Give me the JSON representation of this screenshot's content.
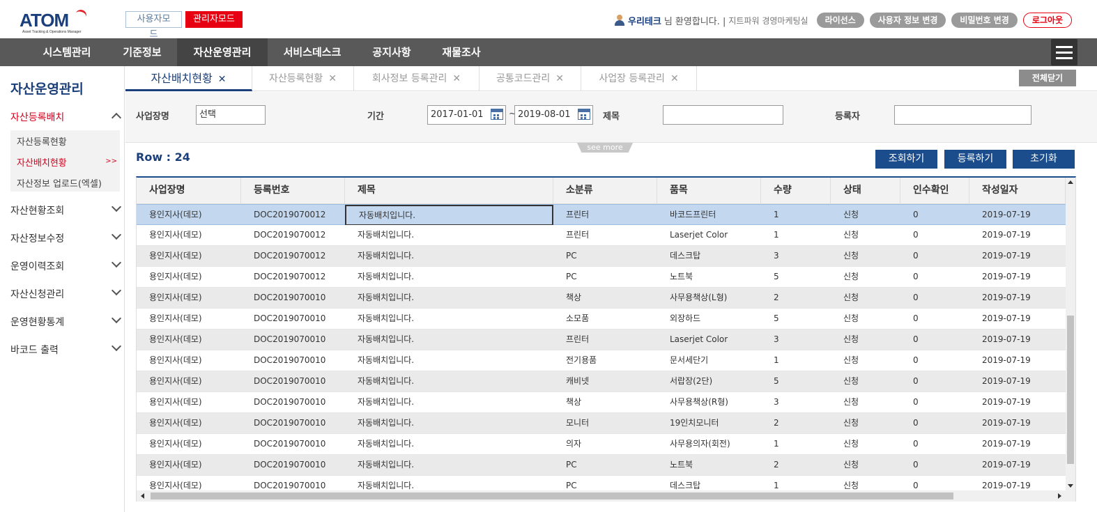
{
  "logo": {
    "text": "ATOM",
    "subtitle": "Asset Tracking & Operations Manager"
  },
  "modes": {
    "user": "사용자모드",
    "admin": "관리자모드"
  },
  "user_bar": {
    "company": "우리테크",
    "welcome": "님 환영합니다. |",
    "org": "지트파워 경영마케팅실",
    "buttons": [
      "라이선스",
      "사용자 정보 변경",
      "비밀번호 변경"
    ],
    "logout": "로그아웃"
  },
  "nav": {
    "items": [
      "시스템관리",
      "기준정보",
      "자산운영관리",
      "서비스데스크",
      "공지사항",
      "재물조사"
    ],
    "active": "자산운영관리"
  },
  "sidebar": {
    "title": "자산운영관리",
    "open_menu": "자산등록배치",
    "submenu": [
      "자산등록현황",
      "자산배치현황",
      "자산정보 업로드(엑셀)"
    ],
    "submenu_arrow": ">>",
    "menus": [
      "자산현황조회",
      "자산정보수정",
      "운영이력조회",
      "자산신청관리",
      "운영현황통계",
      "바코드 출력"
    ]
  },
  "tabs": {
    "items": [
      "자산배치현황",
      "자산등록현황",
      "회사정보 등록관리",
      "공통코드관리",
      "사업장 등록관리"
    ],
    "close_glyph": "✕",
    "close_all": "전체닫기"
  },
  "search": {
    "site_label": "사업장명",
    "site_value": "선택",
    "period_label": "기간",
    "date_from": "2017-01-01",
    "tilde": "~",
    "date_to": "2019-08-01",
    "title_label": "제목",
    "title_value": "",
    "registrant_label": "등록자",
    "registrant_value": "",
    "see_more": "see more"
  },
  "results": {
    "row_count": "Row : 24",
    "buttons": [
      "조회하기",
      "등록하기",
      "초기화"
    ]
  },
  "grid": {
    "columns": [
      "사업장명",
      "등록번호",
      "제목",
      "소분류",
      "품목",
      "수량",
      "상태",
      "인수확인",
      "작성일자"
    ],
    "rows": [
      [
        "용인지사(데모)",
        "DOC2019070012",
        "자동배치입니다.",
        "프린터",
        "바코드프린터",
        "1",
        "신청",
        "0",
        "2019-07-19"
      ],
      [
        "용인지사(데모)",
        "DOC2019070012",
        "자동배치입니다.",
        "프린터",
        "Laserjet Color",
        "1",
        "신청",
        "0",
        "2019-07-19"
      ],
      [
        "용인지사(데모)",
        "DOC2019070012",
        "자동배치입니다.",
        "PC",
        "데스크탑",
        "3",
        "신청",
        "0",
        "2019-07-19"
      ],
      [
        "용인지사(데모)",
        "DOC2019070012",
        "자동배치입니다.",
        "PC",
        "노트북",
        "5",
        "신청",
        "0",
        "2019-07-19"
      ],
      [
        "용인지사(데모)",
        "DOC2019070010",
        "자동배치입니다.",
        "책상",
        "사무용책상(L형)",
        "2",
        "신청",
        "0",
        "2019-07-19"
      ],
      [
        "용인지사(데모)",
        "DOC2019070010",
        "자동배치입니다.",
        "소모품",
        "외장하드",
        "5",
        "신청",
        "0",
        "2019-07-19"
      ],
      [
        "용인지사(데모)",
        "DOC2019070010",
        "자동배치입니다.",
        "프린터",
        "Laserjet Color",
        "3",
        "신청",
        "0",
        "2019-07-19"
      ],
      [
        "용인지사(데모)",
        "DOC2019070010",
        "자동배치입니다.",
        "전기용품",
        "문서세단기",
        "1",
        "신청",
        "0",
        "2019-07-19"
      ],
      [
        "용인지사(데모)",
        "DOC2019070010",
        "자동배치입니다.",
        "캐비넷",
        "서랍장(2단)",
        "5",
        "신청",
        "0",
        "2019-07-19"
      ],
      [
        "용인지사(데모)",
        "DOC2019070010",
        "자동배치입니다.",
        "책상",
        "사무용책상(R형)",
        "3",
        "신청",
        "0",
        "2019-07-19"
      ],
      [
        "용인지사(데모)",
        "DOC2019070010",
        "자동배치입니다.",
        "모니터",
        "19인치모니터",
        "2",
        "신청",
        "0",
        "2019-07-19"
      ],
      [
        "용인지사(데모)",
        "DOC2019070010",
        "자동배치입니다.",
        "의자",
        "사무용의자(회전)",
        "1",
        "신청",
        "0",
        "2019-07-19"
      ],
      [
        "용인지사(데모)",
        "DOC2019070010",
        "자동배치입니다.",
        "PC",
        "노트북",
        "2",
        "신청",
        "0",
        "2019-07-19"
      ],
      [
        "용인지사(데모)",
        "DOC2019070010",
        "자동배치입니다.",
        "PC",
        "데스크탑",
        "1",
        "신청",
        "0",
        "2019-07-19"
      ]
    ]
  },
  "colors": {
    "brand": "#1b3f7a",
    "admin_red": "#e60012",
    "nav_bg": "#595959",
    "button_blue": "#1b4d8c",
    "selected_row": "#c3d7ef"
  }
}
